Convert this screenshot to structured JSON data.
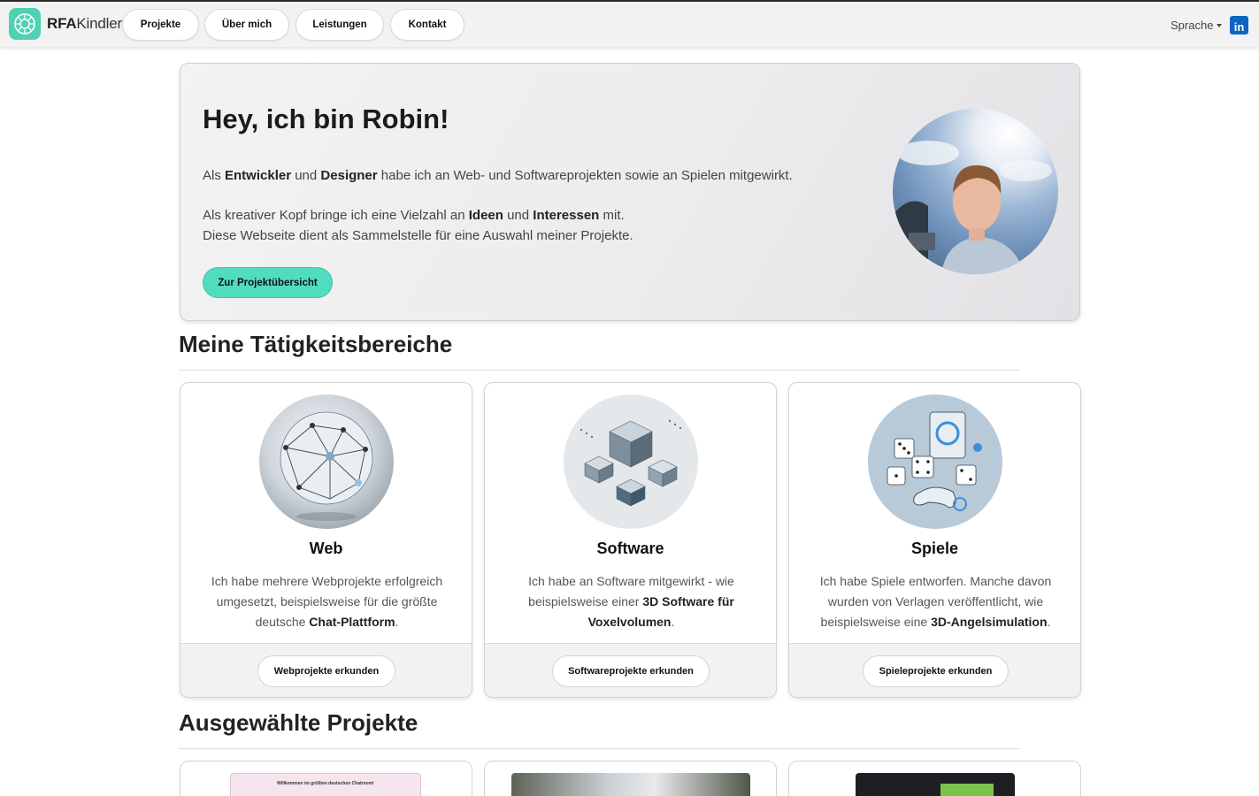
{
  "nav": {
    "brand_bold": "RFA",
    "brand_rest": "Kindler",
    "items": [
      {
        "label": "Projekte"
      },
      {
        "label": "Über mich"
      },
      {
        "label": "Leistungen"
      },
      {
        "label": "Kontakt"
      }
    ],
    "language_label": "Sprache",
    "linkedin_icon": "linkedin-icon"
  },
  "hero": {
    "title": "Hey, ich bin Robin!",
    "p1_pre": "Als ",
    "p1_b1": "Entwickler",
    "p1_mid": " und ",
    "p1_b2": "Designer",
    "p1_post": " habe ich an Web- und Softwareprojekten sowie an Spielen mitgewirkt.",
    "p2_pre": "Als kreativer Kopf bringe ich eine Vielzahl an ",
    "p2_b1": "Ideen",
    "p2_mid": " und ",
    "p2_b2": "Interessen",
    "p2_post": " mit.",
    "p3": "Diese Webseite dient als Sammelstelle für eine Auswahl meiner Projekte.",
    "cta_label": "Zur Projektübersicht"
  },
  "areas": {
    "title": "Meine Tätigkeitsbereiche",
    "cards": [
      {
        "title": "Web",
        "text_pre": "Ich habe mehrere Webprojekte erfolgreich umgesetzt, beispielsweise für die größte deutsche ",
        "text_bold": "Chat-Plattform",
        "text_post": ".",
        "button": "Webprojekte erkunden"
      },
      {
        "title": "Software",
        "text_pre": "Ich habe an Software mitgewirkt - wie beispielsweise einer ",
        "text_bold": "3D Software für Voxelvolumen",
        "text_post": ".",
        "button": "Softwareprojekte erkunden"
      },
      {
        "title": "Spiele",
        "text_pre": "Ich habe Spiele entworfen. Manche davon wurden von Verlagen veröffentlicht, wie beispielsweise eine ",
        "text_bold": "3D-Angelsimulation",
        "text_post": ".",
        "button": "Spieleprojekte erkunden"
      }
    ]
  },
  "projects": {
    "title": "Ausgewählte Projekte",
    "thumb1_title": "Willkommen im größten deutschen Chatroom!"
  },
  "colors": {
    "accent": "#51dcc0",
    "linkedin": "#0a66c2"
  }
}
